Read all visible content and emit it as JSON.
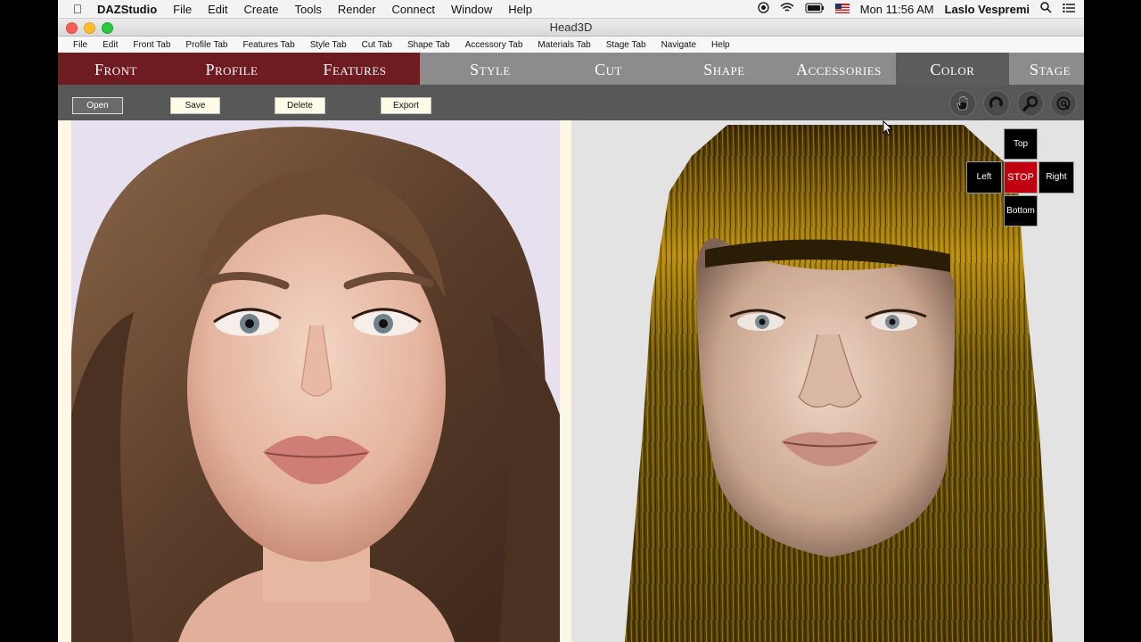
{
  "menubar": {
    "app_name": "DAZStudio",
    "items": [
      "File",
      "Edit",
      "Create",
      "Tools",
      "Render",
      "Connect",
      "Window",
      "Help"
    ],
    "datetime": "Mon 11:56 AM",
    "user": "Laslo Vespremi"
  },
  "window": {
    "title": "Head3D"
  },
  "app_menu": [
    "File",
    "Edit",
    "Front Tab",
    "Profile Tab",
    "Features Tab",
    "Style Tab",
    "Cut Tab",
    "Shape Tab",
    "Accessory Tab",
    "Materials Tab",
    "Stage Tab",
    "Navigate",
    "Help"
  ],
  "tabs": {
    "front": "Front",
    "profile": "Profile",
    "features": "Features",
    "style": "Style",
    "cut": "Cut",
    "shape": "Shape",
    "accessories": "Accessories",
    "color": "Color",
    "stage": "Stage"
  },
  "toolbar": {
    "open": "Open",
    "save": "Save",
    "delete": "Delete",
    "export": "Export"
  },
  "view_tools": [
    "hand-icon",
    "rotate-icon",
    "zoom-icon",
    "fit-icon"
  ],
  "nav_pad": {
    "top": "Top",
    "left": "Left",
    "stop": "STOP",
    "right": "Right",
    "bottom": "Bottom"
  },
  "colors": {
    "front_tabs": "#6e1b22",
    "other_tabs": "#8c8c8c",
    "active_tab": "#5c5c5c",
    "stop": "#c00010"
  }
}
